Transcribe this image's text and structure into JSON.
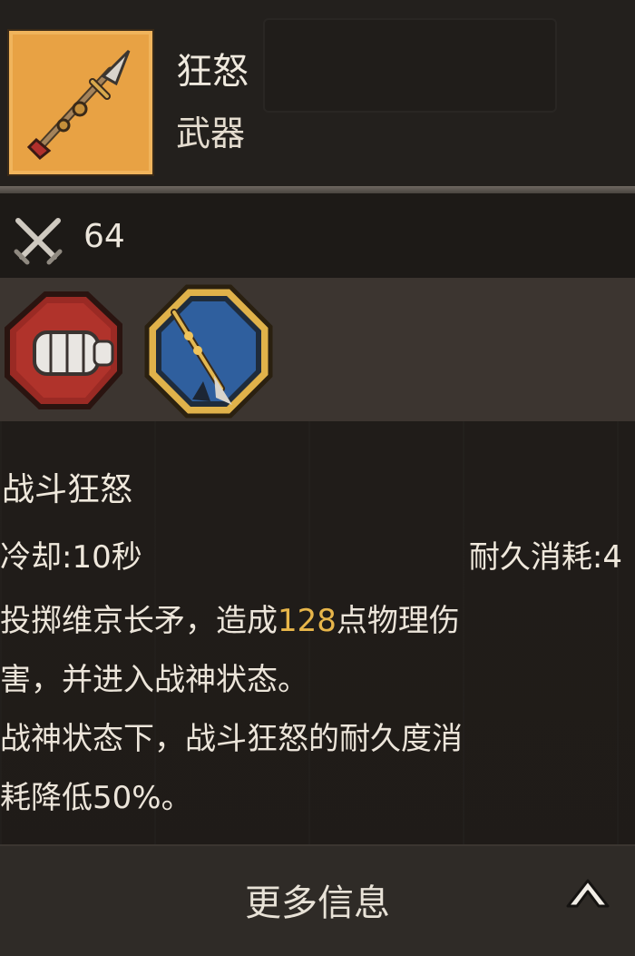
{
  "item": {
    "name": "狂怒",
    "type": "武器",
    "icon": "spear-icon",
    "frame_color": "#e8a244"
  },
  "stats": {
    "attack_icon": "crossed-swords-icon",
    "attack_value": "64"
  },
  "skills": {
    "icons": [
      "fist-skill-icon",
      "spear-skill-icon"
    ]
  },
  "skill_detail": {
    "name": "战斗狂怒",
    "cooldown": "冷却:10秒",
    "durability_cost": "耐久消耗:4",
    "desc_line1_a": "投掷维京长矛，造成",
    "desc_line1_value": "128",
    "desc_line1_b": "点物理伤",
    "desc_line2": "害，并进入战神状态。",
    "desc_line3": "战神状态下，战斗狂怒的耐久度消",
    "desc_line4": "耗降低50%。",
    "highlight_color": "#e8b64a"
  },
  "footer": {
    "more_info_label": "更多信息",
    "expand_icon": "chevron-up-icon"
  }
}
